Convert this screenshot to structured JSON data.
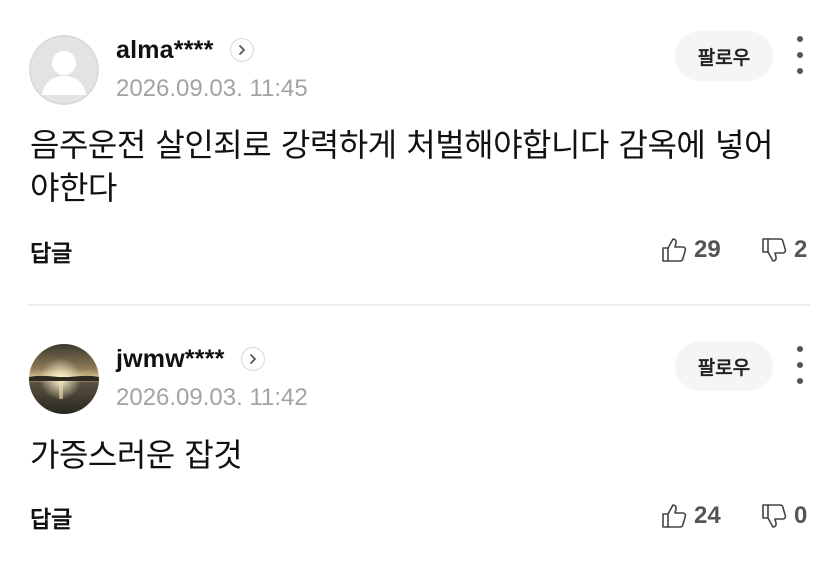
{
  "comments": [
    {
      "nickname": "alma****",
      "timestamp": "2026.09.03. 11:45",
      "text": "음주운전 살인죄로 강력하게 처벌해야합니다 감옥에 넣어야한다",
      "follow_label": "팔로우",
      "reply_label": "답글",
      "likes": "29",
      "dislikes": "2",
      "avatar": "default-profile-icon"
    },
    {
      "nickname": "jwmw****",
      "timestamp": "2026.09.03. 11:42",
      "text": "가증스러운 잡것",
      "follow_label": "팔로우",
      "reply_label": "답글",
      "likes": "24",
      "dislikes": "0",
      "avatar": "sunset-lake-photo"
    }
  ],
  "colors": {
    "text": "#111111",
    "timestamp": "#a3a3a3",
    "counts": "#555555",
    "follow_bg": "#f4f5f7",
    "divider": "#ececec"
  }
}
